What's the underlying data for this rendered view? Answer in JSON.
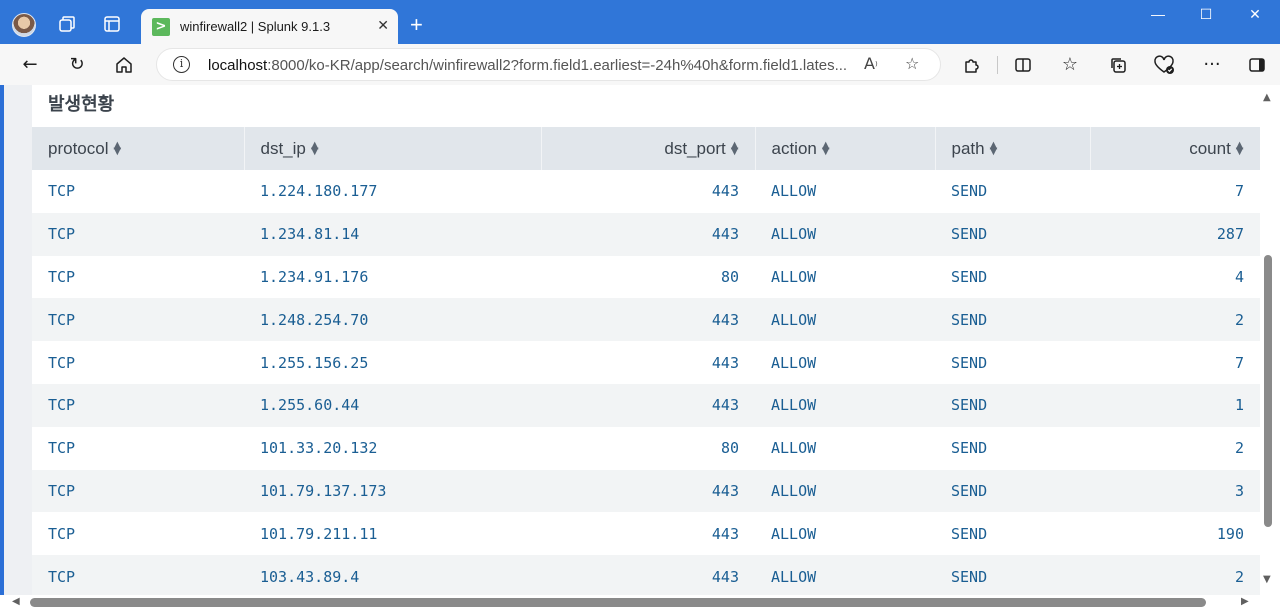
{
  "browser": {
    "tab_title": "winfirewall2 | Splunk 9.1.3",
    "tab_favicon_glyph": ">",
    "url_host": "localhost",
    "url_rest": ":8000/ko-KR/app/search/winfirewall2?form.field1.earliest=-24h%40h&form.field1.lates..."
  },
  "panel": {
    "title": "발생현황"
  },
  "table": {
    "columns": [
      "protocol",
      "dst_ip",
      "dst_port",
      "action",
      "path",
      "count"
    ],
    "rows": [
      [
        "TCP",
        "1.224.180.177",
        "443",
        "ALLOW",
        "SEND",
        "7"
      ],
      [
        "TCP",
        "1.234.81.14",
        "443",
        "ALLOW",
        "SEND",
        "287"
      ],
      [
        "TCP",
        "1.234.91.176",
        "80",
        "ALLOW",
        "SEND",
        "4"
      ],
      [
        "TCP",
        "1.248.254.70",
        "443",
        "ALLOW",
        "SEND",
        "2"
      ],
      [
        "TCP",
        "1.255.156.25",
        "443",
        "ALLOW",
        "SEND",
        "7"
      ],
      [
        "TCP",
        "1.255.60.44",
        "443",
        "ALLOW",
        "SEND",
        "1"
      ],
      [
        "TCP",
        "101.33.20.132",
        "80",
        "ALLOW",
        "SEND",
        "2"
      ],
      [
        "TCP",
        "101.79.137.173",
        "443",
        "ALLOW",
        "SEND",
        "3"
      ],
      [
        "TCP",
        "101.79.211.11",
        "443",
        "ALLOW",
        "SEND",
        "190"
      ],
      [
        "TCP",
        "103.43.89.4",
        "443",
        "ALLOW",
        "SEND",
        "2"
      ]
    ]
  },
  "colors": {
    "titlebar": "#3076d8",
    "link_text": "#1a5e93",
    "header_bg": "#e1e6eb"
  }
}
